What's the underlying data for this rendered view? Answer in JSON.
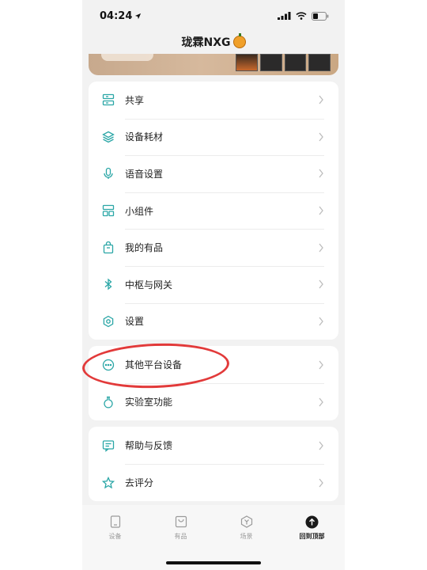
{
  "status_bar": {
    "time": "04:24"
  },
  "header": {
    "title": "珑霖NXG"
  },
  "menu_group_1": [
    {
      "label": "共享",
      "icon": "share-icon"
    },
    {
      "label": "设备耗材",
      "icon": "layers-icon"
    },
    {
      "label": "语音设置",
      "icon": "microphone-icon"
    },
    {
      "label": "小组件",
      "icon": "widget-icon"
    },
    {
      "label": "我的有品",
      "icon": "shopping-bag-icon"
    },
    {
      "label": "中枢与网关",
      "icon": "bluetooth-icon"
    },
    {
      "label": "设置",
      "icon": "settings-icon"
    }
  ],
  "menu_group_2": [
    {
      "label": "其他平台设备",
      "icon": "more-dots-icon"
    },
    {
      "label": "实验室功能",
      "icon": "flask-icon"
    }
  ],
  "menu_group_3": [
    {
      "label": "帮助与反馈",
      "icon": "feedback-icon"
    },
    {
      "label": "去评分",
      "icon": "star-icon"
    }
  ],
  "tabbar": [
    {
      "label": "设备",
      "icon": "device-icon",
      "active": false
    },
    {
      "label": "有品",
      "icon": "store-icon",
      "active": false
    },
    {
      "label": "场景",
      "icon": "scene-icon",
      "active": false
    },
    {
      "label": "回到顶部",
      "icon": "arrow-up-icon",
      "active": true
    }
  ],
  "colors": {
    "icon_teal": "#2aa6a6",
    "annotation_red": "#e23a3a",
    "chevron": "#bdbdbd"
  }
}
